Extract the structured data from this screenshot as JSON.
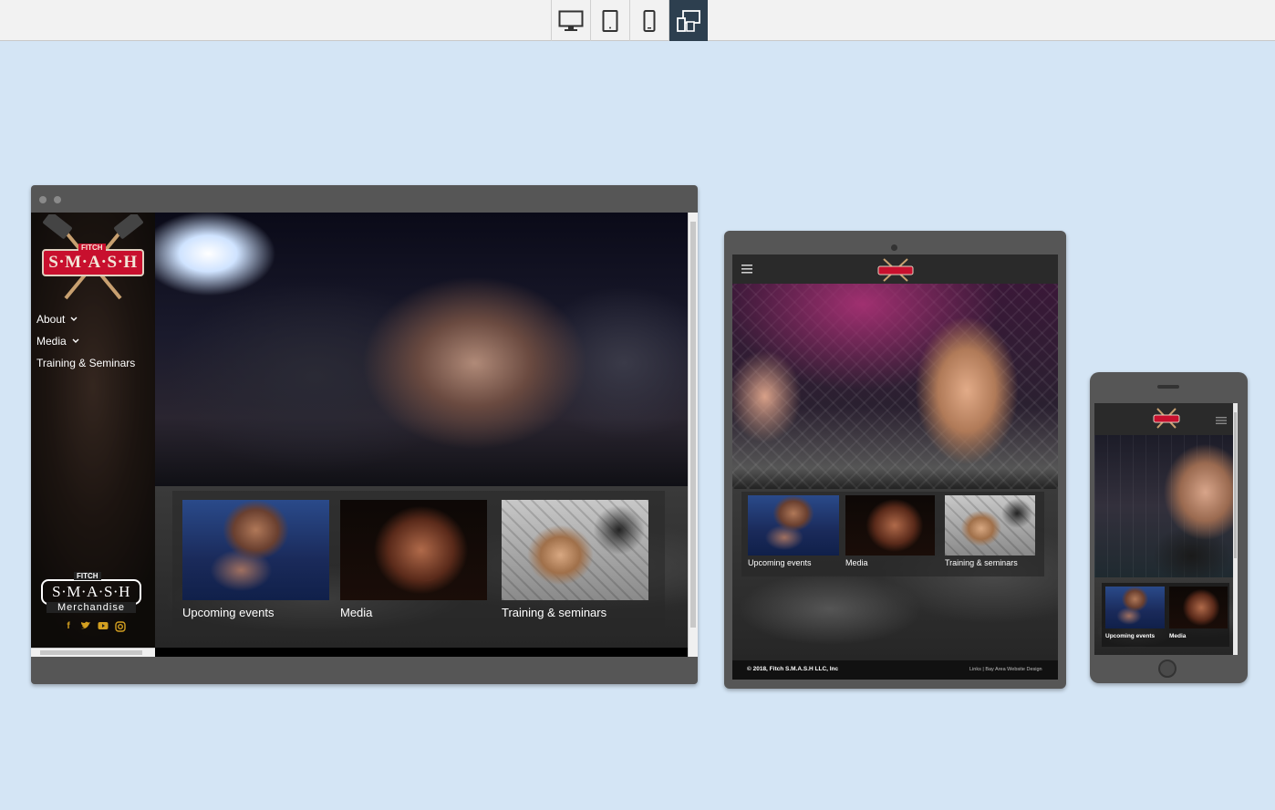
{
  "toolbar": {
    "buttons": [
      {
        "name": "desktop-view-button",
        "icon": "desktop-icon"
      },
      {
        "name": "tablet-view-button",
        "icon": "tablet-icon"
      },
      {
        "name": "mobile-view-button",
        "icon": "mobile-icon"
      },
      {
        "name": "all-devices-view-button",
        "icon": "responsive-devices-icon",
        "active": true
      }
    ],
    "active_color": "#2d3f4f"
  },
  "site": {
    "logo": {
      "top": "FITCH",
      "main": "S·M·A·S·H"
    },
    "nav": [
      {
        "label": "About",
        "has_dropdown": true
      },
      {
        "label": "Media",
        "has_dropdown": true
      },
      {
        "label": "Training & Seminars",
        "has_dropdown": false
      }
    ],
    "merch": {
      "top": "FITCH",
      "main": "S·M·A·S·H",
      "sub": "Merchandise"
    },
    "social": [
      "facebook-icon",
      "twitter-icon",
      "youtube-icon",
      "instagram-icon"
    ],
    "tiles": [
      {
        "label": "Upcoming events",
        "image": "bellator-fighters"
      },
      {
        "label": "Media",
        "image": "screaming-fighter"
      },
      {
        "label": "Training & seminars",
        "image": "grappling-match"
      }
    ],
    "mobile_tiles": [
      "Upcoming events",
      "Media"
    ],
    "footer": {
      "copyright": "© 2018, Fitch S.M.A.S.H LLC, Inc",
      "links": "Links | Bay Area Website Design"
    },
    "accent_color": "#c8102e"
  }
}
